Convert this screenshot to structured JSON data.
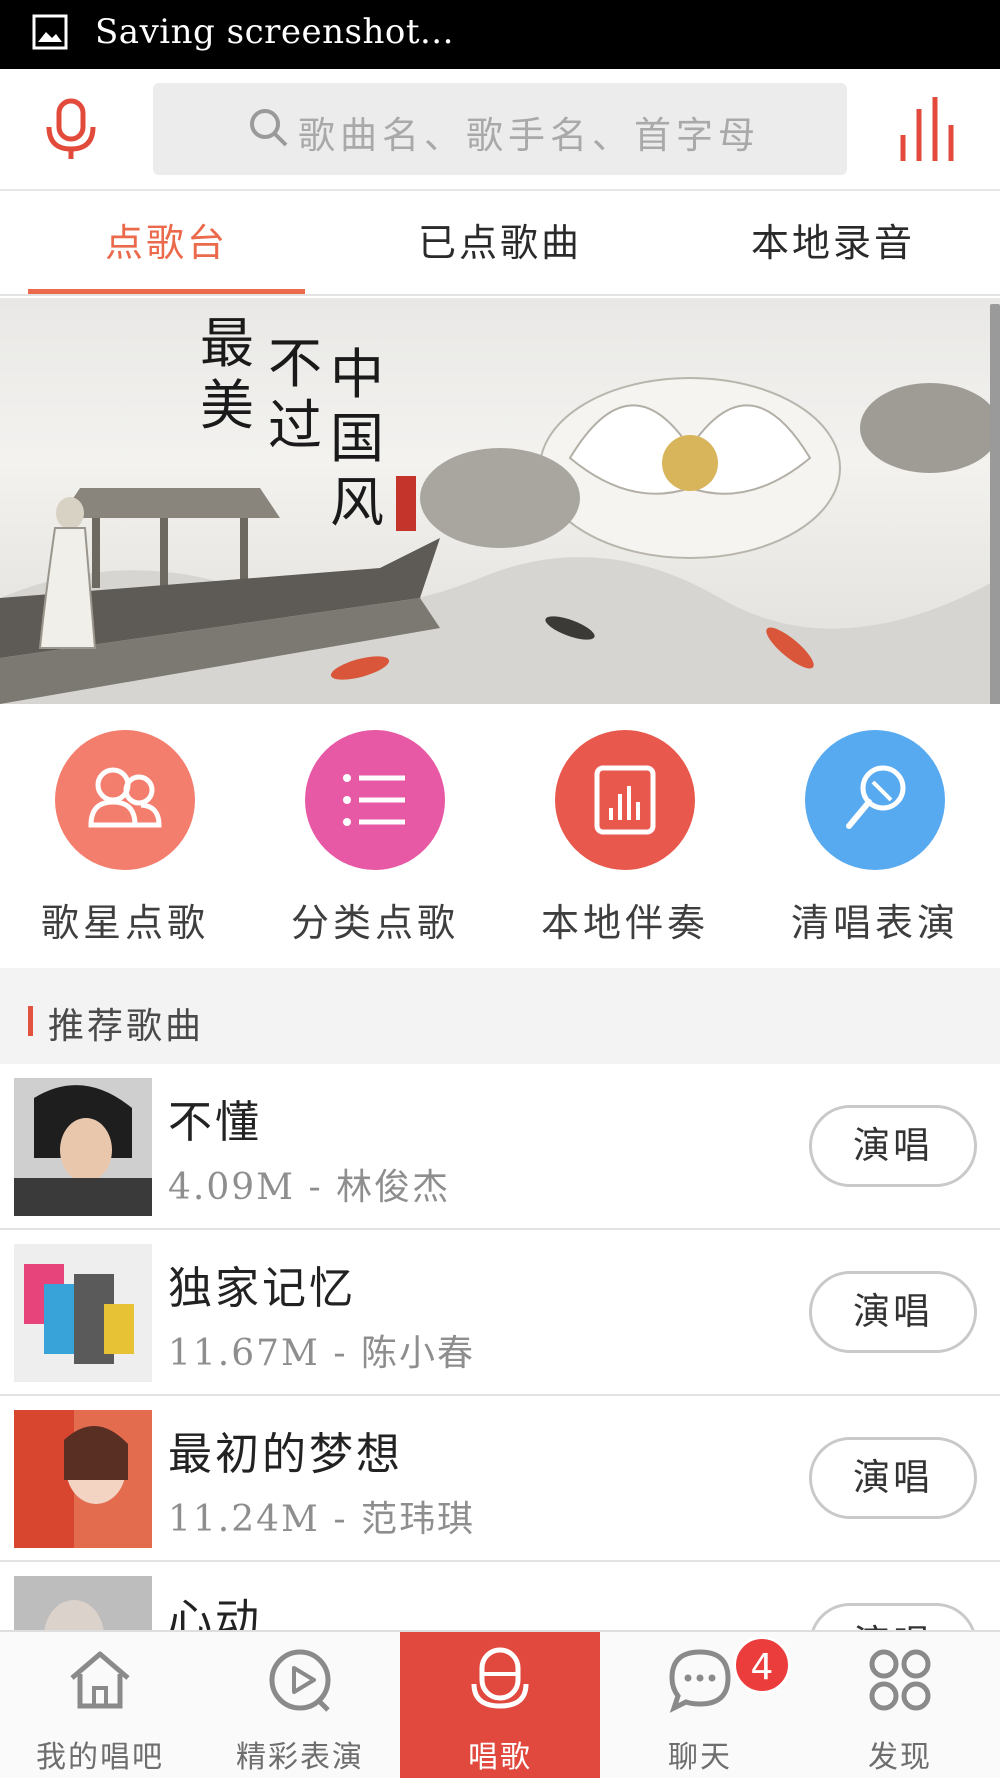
{
  "status_bar": {
    "text": "Saving screenshot..."
  },
  "search": {
    "placeholder": "歌曲名、歌手名、首字母"
  },
  "tabs": [
    {
      "label": "点歌台",
      "active": true
    },
    {
      "label": "已点歌曲",
      "active": false
    },
    {
      "label": "本地录音",
      "active": false
    }
  ],
  "banner": {
    "text": [
      "最",
      "美",
      "不",
      "过",
      "中",
      "国",
      "风"
    ]
  },
  "categories": [
    {
      "label": "歌星点歌",
      "icon": "singers-icon",
      "color": "#f47e6e"
    },
    {
      "label": "分类点歌",
      "icon": "list-icon",
      "color": "#e758a5"
    },
    {
      "label": "本地伴奏",
      "icon": "local-audio-icon",
      "color": "#e8584c"
    },
    {
      "label": "清唱表演",
      "icon": "microphone-icon",
      "color": "#57aaf0"
    }
  ],
  "section": {
    "title": "推荐歌曲"
  },
  "songs": [
    {
      "title": "不懂",
      "size": "4.09M",
      "artist": "林俊杰",
      "button": "演唱"
    },
    {
      "title": "独家记忆",
      "size": "11.67M",
      "artist": "陈小春",
      "button": "演唱"
    },
    {
      "title": "最初的梦想",
      "size": "11.24M",
      "artist": "范玮琪",
      "button": "演唱"
    },
    {
      "title": "心动",
      "size": "",
      "artist": "",
      "button": "演唱"
    }
  ],
  "bottom_nav": [
    {
      "label": "我的唱吧",
      "icon": "home-icon",
      "active": false
    },
    {
      "label": "精彩表演",
      "icon": "play-icon",
      "active": false
    },
    {
      "label": "唱歌",
      "icon": "mic-icon",
      "active": true
    },
    {
      "label": "聊天",
      "icon": "chat-icon",
      "active": false,
      "badge": "4"
    },
    {
      "label": "发现",
      "icon": "discover-icon",
      "active": false
    }
  ],
  "colors": {
    "accent": "#ec6a4c",
    "nav_active": "#e1493f",
    "badge": "#ec3d3d"
  }
}
